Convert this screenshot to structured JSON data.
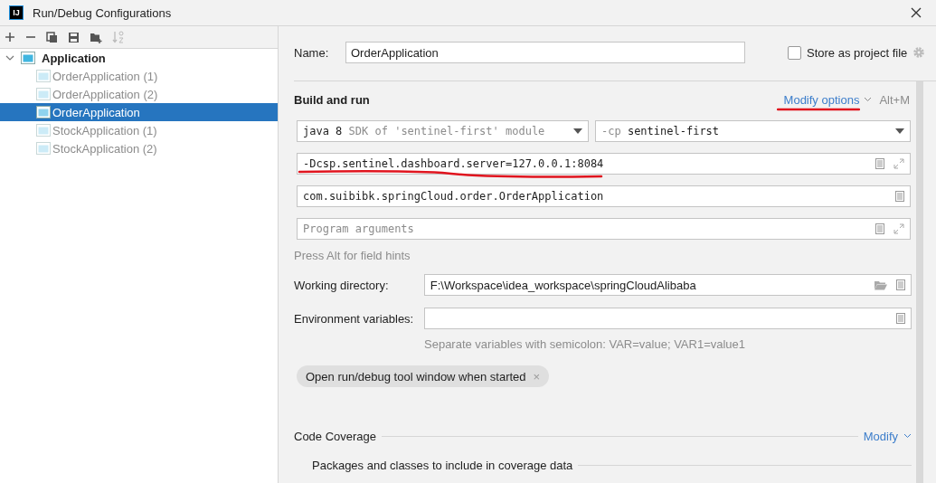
{
  "window": {
    "logo": "IJ",
    "title": "Run/Debug Configurations"
  },
  "tree": {
    "label": "Application",
    "expanded": true,
    "children": [
      {
        "label": "OrderApplication (1)",
        "selected": false,
        "temporary": true
      },
      {
        "label": "OrderApplication (2)",
        "selected": false,
        "temporary": true
      },
      {
        "label": "OrderApplication",
        "selected": true,
        "temporary": false
      },
      {
        "label": "StockApplication (1)",
        "selected": false,
        "temporary": true
      },
      {
        "label": "StockApplication (2)",
        "selected": false,
        "temporary": true
      }
    ]
  },
  "name": {
    "label": "Name:",
    "value": "OrderApplication"
  },
  "store_as_project_file": {
    "label": "Store as project file",
    "checked": false
  },
  "build_and_run": {
    "title": "Build and run",
    "modify_options": "Modify options",
    "shortcut": "Alt+M",
    "jre": {
      "value": "java 8",
      "hint": "SDK of 'sentinel-first' module"
    },
    "classpath": {
      "prefix": "-cp",
      "value": "sentinel-first"
    },
    "vm_options": "-Dcsp.sentinel.dashboard.server=127.0.0.1:8084",
    "main_class": "com.suibibk.springCloud.order.OrderApplication",
    "program_arguments": {
      "placeholder": "Program arguments"
    },
    "field_hint": "Press Alt for field hints"
  },
  "working_directory": {
    "label": "Working directory:",
    "value": "F:\\Workspace\\idea_workspace\\springCloudAlibaba"
  },
  "environment_variables": {
    "label": "Environment variables:",
    "hint": "Separate variables with semicolon: VAR=value; VAR1=value1"
  },
  "chips": [
    {
      "label": "Open run/debug tool window when started",
      "close": "×"
    }
  ],
  "code_coverage": {
    "title": "Code Coverage",
    "modify": "Modify",
    "packages": "Packages and classes to include in coverage data"
  }
}
